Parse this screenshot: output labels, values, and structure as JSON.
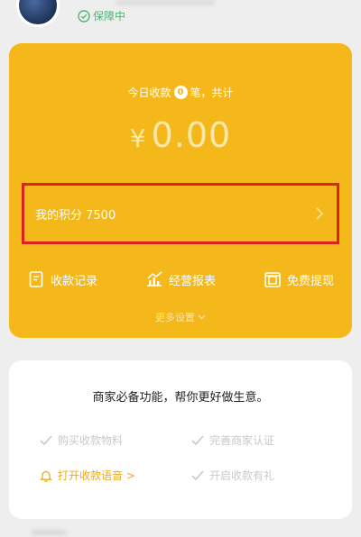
{
  "profile": {
    "protect_text": "保障中"
  },
  "card": {
    "today_prefix": "今日收款",
    "today_count": "0",
    "today_suffix": "笔，共计",
    "currency": "¥",
    "amount": "0.00",
    "points_label": "我的积分 7500",
    "actions": [
      {
        "label": "收款记录",
        "icon": "receipt-icon"
      },
      {
        "label": "经营报表",
        "icon": "report-chart-icon"
      },
      {
        "label": "免费提现",
        "icon": "withdraw-icon"
      }
    ],
    "more_settings": "更多设置"
  },
  "features": {
    "title": "商家必备功能，帮你更好做生意。",
    "items": [
      {
        "label": "购买收款物料",
        "icon": "check-icon",
        "active": false
      },
      {
        "label": "完善商家认证",
        "icon": "check-icon",
        "active": false
      },
      {
        "label": "打开收款语音 >",
        "icon": "bell-icon",
        "active": true
      },
      {
        "label": "开启收款有礼",
        "icon": "check-icon",
        "active": false
      }
    ]
  },
  "colors": {
    "brand_yellow": "#f5b81b",
    "highlight_red": "#e0201b",
    "active_orange": "#f0a81b",
    "muted_gray": "#c9c9c9",
    "protect_green": "#55b27a"
  }
}
